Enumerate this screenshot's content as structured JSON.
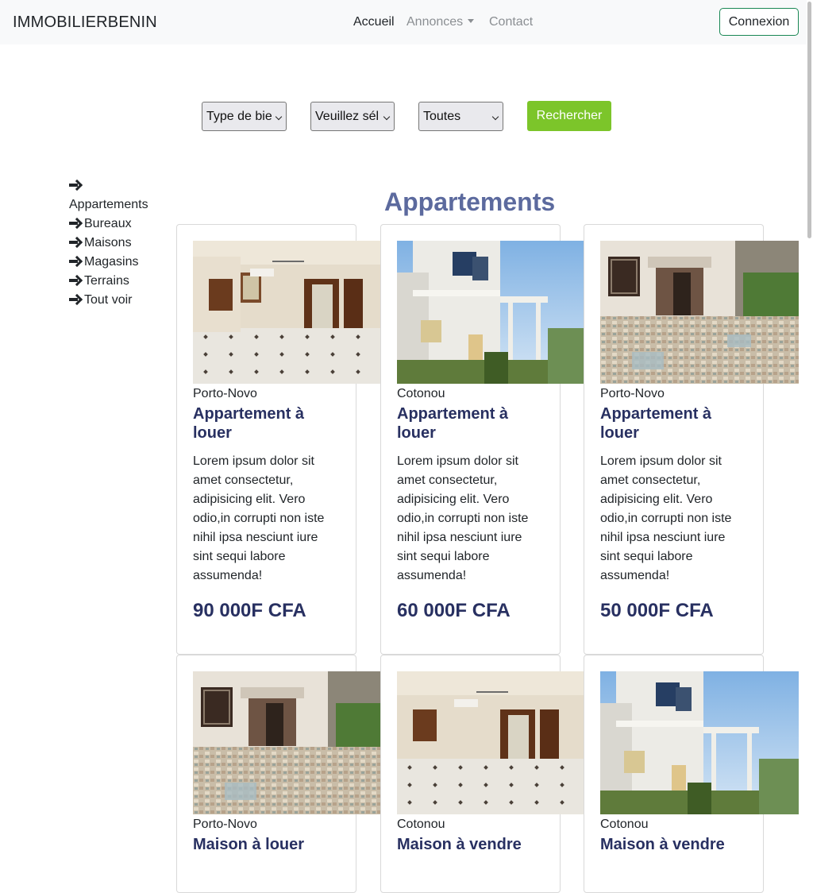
{
  "navbar": {
    "brand": "IMMOBILIERBENIN",
    "links": [
      {
        "label": "Accueil"
      },
      {
        "label": "Annonces"
      },
      {
        "label": "Contact"
      }
    ],
    "login_label": "Connexion",
    "login_border_color": "#198754"
  },
  "search": {
    "type_select": "Type de bie",
    "city_select": "Veuillez sél",
    "category_select": "Toutes",
    "submit_label": "Rechercher",
    "submit_color": "#7cc52a"
  },
  "sidebar": {
    "items": [
      {
        "label": "Appartements"
      },
      {
        "label": "Bureaux"
      },
      {
        "label": "Maisons"
      },
      {
        "label": "Magasins"
      },
      {
        "label": "Terrains"
      },
      {
        "label": "Tout voir"
      }
    ],
    "icon": "arrow-right-icon"
  },
  "main": {
    "title": "Appartements",
    "title_color": "#5c6a9e",
    "accent_color": "#283061",
    "cards": [
      {
        "city": "Porto-Novo",
        "title": "Appartement à louer",
        "description": "Lorem ipsum dolor sit amet consectetur, adipisicing elit. Vero odio,in corrupti non iste nihil ipsa nesciunt iure sint sequi labore assumenda!",
        "price": "90 000F CFA",
        "image": "interior-room-photo"
      },
      {
        "city": "Cotonou",
        "title": "Appartement à louer",
        "description": "Lorem ipsum dolor sit amet consectetur, adipisicing elit. Vero odio,in corrupti non iste nihil ipsa nesciunt iure sint sequi labore assumenda!",
        "price": "60 000F CFA",
        "image": "house-exterior-photo"
      },
      {
        "city": "Porto-Novo",
        "title": "Appartement à louer",
        "description": "Lorem ipsum dolor sit amet consectetur, adipisicing elit. Vero odio,in corrupti non iste nihil ipsa nesciunt iure sint sequi labore assumenda!",
        "price": "50 000F CFA",
        "image": "courtyard-photo"
      },
      {
        "city": "Porto-Novo",
        "title": "Maison à louer",
        "image": "courtyard-photo"
      },
      {
        "city": "Cotonou",
        "title": "Maison à vendre",
        "image": "interior-room-photo"
      },
      {
        "city": "Cotonou",
        "title": "Maison à vendre",
        "image": "house-exterior-photo"
      }
    ]
  }
}
